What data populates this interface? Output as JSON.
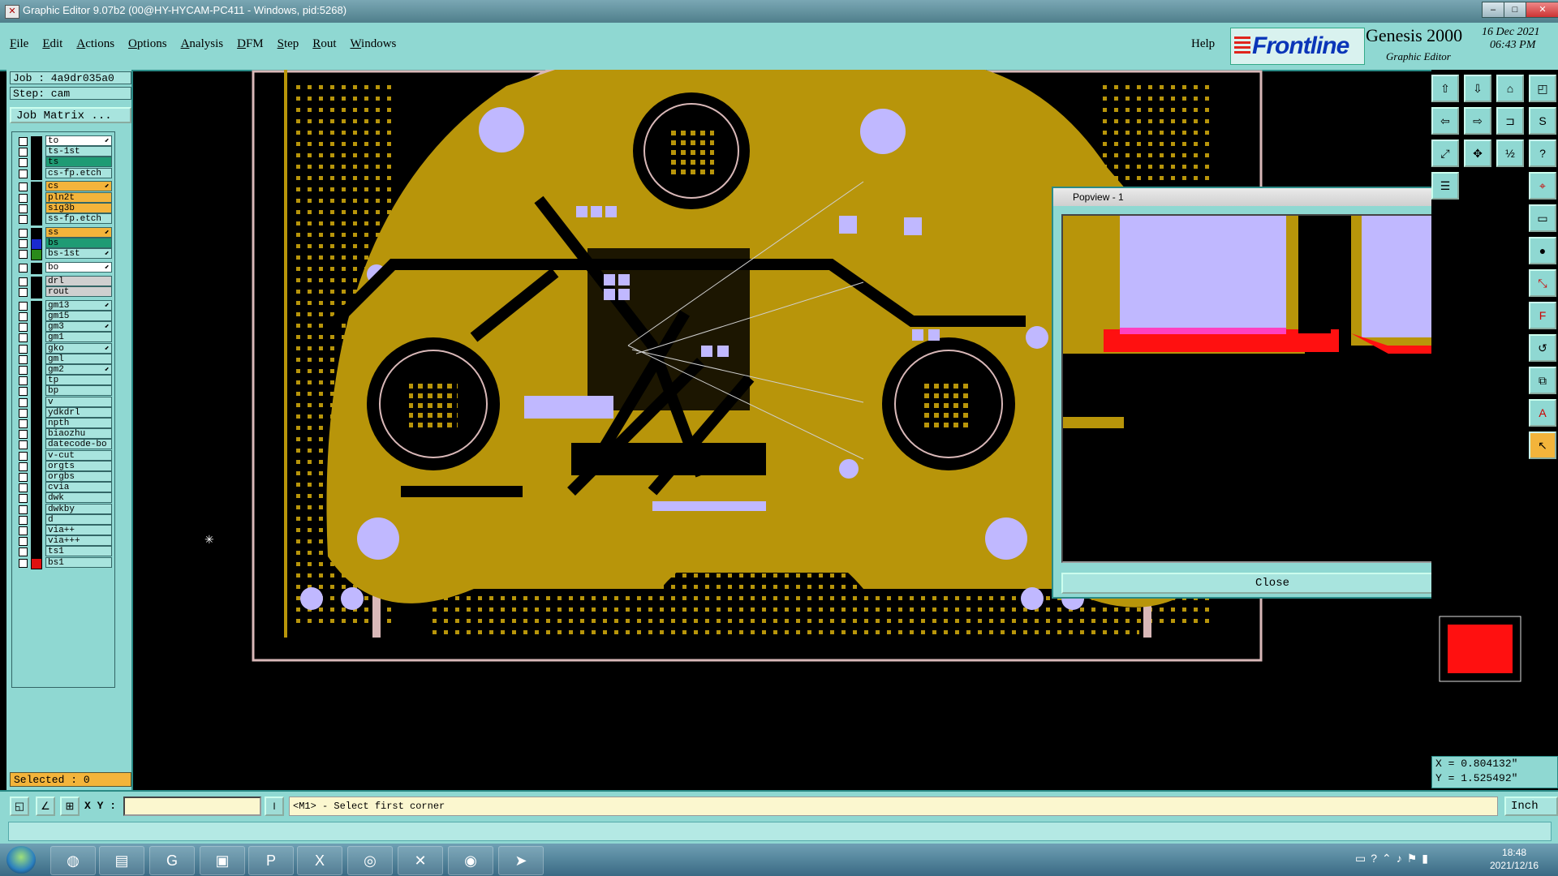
{
  "window": {
    "title": "Graphic Editor 9.07b2 (00@HY-HYCAM-PC411 - Windows, pid:5268)"
  },
  "menu": {
    "items": [
      "File",
      "Edit",
      "Actions",
      "Options",
      "Analysis",
      "DFM",
      "Step",
      "Rout",
      "Windows"
    ],
    "help": "Help"
  },
  "brand": {
    "logo": "Frontline",
    "product": "Genesis 2000",
    "subtitle": "Graphic Editor",
    "date": "16 Dec 2021",
    "time": "06:43 PM"
  },
  "job": {
    "name": "Job : 4a9dr035a0",
    "step": "Step: cam",
    "matrix_button": "Job Matrix ..."
  },
  "layers": [
    {
      "name": "to",
      "swatch": "#000000",
      "style": "sel",
      "arrow": true
    },
    {
      "name": "ts-1st",
      "swatch": "#000000",
      "style": "",
      "arrow": false
    },
    {
      "name": "ts",
      "swatch": "#000000",
      "style": "g",
      "arrow": false
    },
    {
      "name": "cs-fp.etch",
      "swatch": "#000000",
      "style": "",
      "arrow": false
    },
    {
      "name": "cs",
      "swatch": "#000000",
      "style": "y",
      "arrow": true
    },
    {
      "name": "pln2t",
      "swatch": "#000000",
      "style": "y",
      "arrow": false
    },
    {
      "name": "sig3b",
      "swatch": "#000000",
      "style": "y",
      "arrow": false
    },
    {
      "name": "ss-fp.etch",
      "swatch": "#000000",
      "style": "",
      "arrow": false
    },
    {
      "name": "ss",
      "swatch": "#000000",
      "style": "y",
      "arrow": true
    },
    {
      "name": "bs",
      "swatch": "#1a2ad0",
      "style": "g",
      "arrow": false
    },
    {
      "name": "bs-1st",
      "swatch": "#2a8a1a",
      "style": "",
      "arrow": true
    },
    {
      "name": "bo",
      "swatch": "#000000",
      "style": "sel",
      "arrow": true
    },
    {
      "name": "drl",
      "swatch": "#000000",
      "style": "gr",
      "arrow": false
    },
    {
      "name": "rout",
      "swatch": "#000000",
      "style": "gr",
      "arrow": false
    },
    {
      "name": "gm13",
      "swatch": "#000000",
      "style": "",
      "arrow": true
    },
    {
      "name": "gm15",
      "swatch": "#000000",
      "style": "",
      "arrow": false
    },
    {
      "name": "gm3",
      "swatch": "#000000",
      "style": "",
      "arrow": true
    },
    {
      "name": "gm1",
      "swatch": "#000000",
      "style": "",
      "arrow": false
    },
    {
      "name": "gko",
      "swatch": "#000000",
      "style": "",
      "arrow": true
    },
    {
      "name": "gml",
      "swatch": "#000000",
      "style": "",
      "arrow": false
    },
    {
      "name": "gm2",
      "swatch": "#000000",
      "style": "",
      "arrow": true
    },
    {
      "name": "tp",
      "swatch": "#000000",
      "style": "",
      "arrow": false
    },
    {
      "name": "bp",
      "swatch": "#000000",
      "style": "",
      "arrow": false
    },
    {
      "name": "v",
      "swatch": "#000000",
      "style": "",
      "arrow": false
    },
    {
      "name": "ydkdrl",
      "swatch": "#000000",
      "style": "",
      "arrow": false
    },
    {
      "name": "npth",
      "swatch": "#000000",
      "style": "",
      "arrow": false
    },
    {
      "name": "biaozhu",
      "swatch": "#000000",
      "style": "",
      "arrow": false
    },
    {
      "name": "datecode-bo",
      "swatch": "#000000",
      "style": "",
      "arrow": false
    },
    {
      "name": "v-cut",
      "swatch": "#000000",
      "style": "",
      "arrow": false
    },
    {
      "name": "orgts",
      "swatch": "#000000",
      "style": "",
      "arrow": false
    },
    {
      "name": "orgbs",
      "swatch": "#000000",
      "style": "",
      "arrow": false
    },
    {
      "name": "cvia",
      "swatch": "#000000",
      "style": "",
      "arrow": false
    },
    {
      "name": "dwk",
      "swatch": "#000000",
      "style": "",
      "arrow": false
    },
    {
      "name": "dwkby",
      "swatch": "#000000",
      "style": "",
      "arrow": false
    },
    {
      "name": "d",
      "swatch": "#000000",
      "style": "",
      "arrow": false
    },
    {
      "name": "via++",
      "swatch": "#000000",
      "style": "",
      "arrow": false
    },
    {
      "name": "via+++",
      "swatch": "#000000",
      "style": "",
      "arrow": false
    },
    {
      "name": "ts1",
      "swatch": "#000000",
      "style": "",
      "arrow": false
    },
    {
      "name": "bs1",
      "swatch": "#e01010",
      "style": "",
      "arrow": false
    }
  ],
  "selected": "Selected : 0",
  "status": {
    "xy_label": "X Y :",
    "xy_value": "",
    "prompt": "<M1> - Select first corner",
    "units": "Inch"
  },
  "coords": {
    "x": "X = 0.804132\"",
    "y": "Y = 1.525492\""
  },
  "popview": {
    "title": "Popview - 1",
    "close": "Close"
  },
  "clock": {
    "time": "18:48",
    "date": "2021/12/16"
  },
  "colors": {
    "panel": "#8fd8d2",
    "copper": "#b8950a",
    "pad": "#c0b8ff",
    "highlight": "#ff1010"
  }
}
